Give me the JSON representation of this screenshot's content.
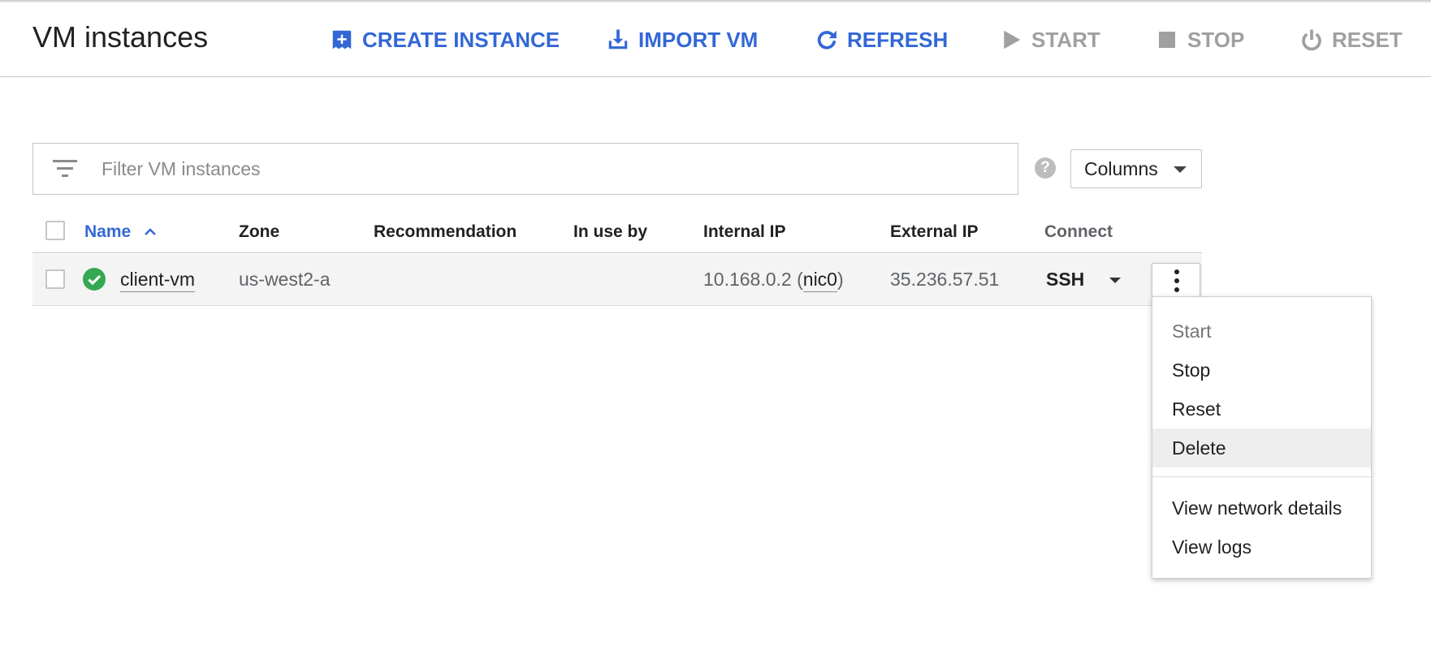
{
  "header": {
    "title": "VM instances",
    "toolbar": [
      {
        "label": "CREATE INSTANCE",
        "icon": "add-box-icon",
        "enabled": true
      },
      {
        "label": "IMPORT VM",
        "icon": "download-icon",
        "enabled": true
      },
      {
        "label": "REFRESH",
        "icon": "refresh-icon",
        "enabled": true
      },
      {
        "label": "START",
        "icon": "play-icon",
        "enabled": false
      },
      {
        "label": "STOP",
        "icon": "stop-icon",
        "enabled": false
      },
      {
        "label": "RESET",
        "icon": "power-icon",
        "enabled": false
      }
    ]
  },
  "filter": {
    "placeholder": "Filter VM instances",
    "value": "",
    "help_symbol": "?"
  },
  "columns_button": {
    "label": "Columns"
  },
  "table": {
    "columns": [
      "Name",
      "Zone",
      "Recommendation",
      "In use by",
      "Internal IP",
      "External IP",
      "Connect"
    ],
    "sort_indicator": "^",
    "rows": [
      {
        "status": "running",
        "name": "client-vm",
        "zone": "us-west2-a",
        "recommendation": "",
        "in_use_by": "",
        "internal_ip": "10.168.0.2",
        "internal_ip_nic": "nic0",
        "external_ip": "35.236.57.51",
        "connect": "SSH"
      }
    ]
  },
  "row_menu": {
    "items": [
      {
        "label": "Start",
        "enabled": false
      },
      {
        "label": "Stop",
        "enabled": true
      },
      {
        "label": "Reset",
        "enabled": true
      },
      {
        "label": "Delete",
        "enabled": true,
        "highlighted": true
      },
      {
        "label": "View network details",
        "enabled": true
      },
      {
        "label": "View logs",
        "enabled": true
      }
    ]
  },
  "colors": {
    "accent_blue": "#3367d6",
    "disabled_gray": "#a0a0a0",
    "status_green": "#34a853",
    "row_background": "#f4f4f4"
  }
}
